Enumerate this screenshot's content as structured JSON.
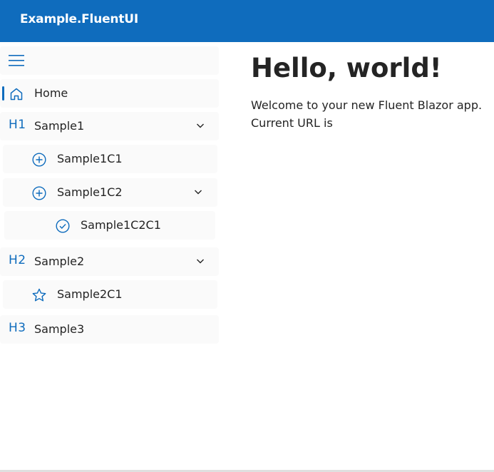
{
  "header": {
    "title": "Example.FluentUI"
  },
  "nav": {
    "toggle_icon": "hamburger-menu-icon",
    "accent_color": "#0f6cbd",
    "items": [
      {
        "label": "Home",
        "icon": "home-icon",
        "active": true
      },
      {
        "label": "Sample1",
        "icon_text": "H1",
        "expanded": true
      },
      {
        "label": "Sample1C1",
        "icon": "add-circle-icon"
      },
      {
        "label": "Sample1C2",
        "icon": "add-circle-icon",
        "expanded": true
      },
      {
        "label": "Sample1C2C1",
        "icon": "checkmark-circle-icon"
      },
      {
        "label": "Sample2",
        "icon_text": "H2",
        "expanded": true
      },
      {
        "label": "Sample2C1",
        "icon": "star-icon"
      },
      {
        "label": "Sample3",
        "icon_text": "H3"
      }
    ]
  },
  "main": {
    "heading": "Hello, world!",
    "welcome_text": "Welcome to your new Fluent Blazor app.",
    "url_text": "Current URL is"
  }
}
